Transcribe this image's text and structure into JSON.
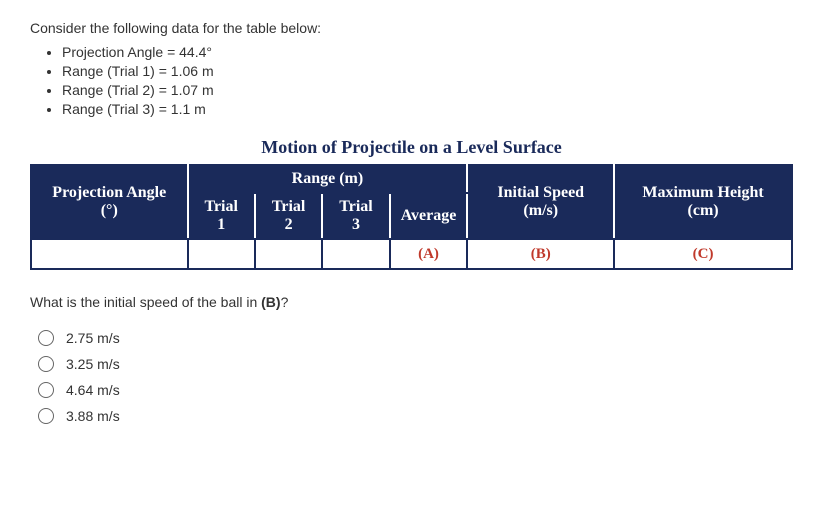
{
  "intro": "Consider the following data for the table below:",
  "givens": [
    "Projection Angle = 44.4°",
    "Range (Trial 1) = 1.06 m",
    "Range (Trial 2) = 1.07 m",
    "Range (Trial 3) = 1.1 m"
  ],
  "table": {
    "title": "Motion of Projectile on a Level Surface",
    "headers": {
      "projection": "Projection Angle (°)",
      "range_group": "Range (m)",
      "trial1": "Trial 1",
      "trial2": "Trial 2",
      "trial3": "Trial 3",
      "average": "Average",
      "initial_speed": "Initial Speed (m/s)",
      "max_height": "Maximum Height (cm)"
    },
    "cells": {
      "projection": "",
      "trial1": "",
      "trial2": "",
      "trial3": "",
      "average": "(A)",
      "initial_speed": "(B)",
      "max_height": "(C)"
    }
  },
  "question_prefix": "What is the initial speed of the ball in ",
  "question_bold": "(B)",
  "question_suffix": "?",
  "options": [
    "2.75 m/s",
    "3.25 m/s",
    "4.64 m/s",
    "3.88 m/s"
  ]
}
